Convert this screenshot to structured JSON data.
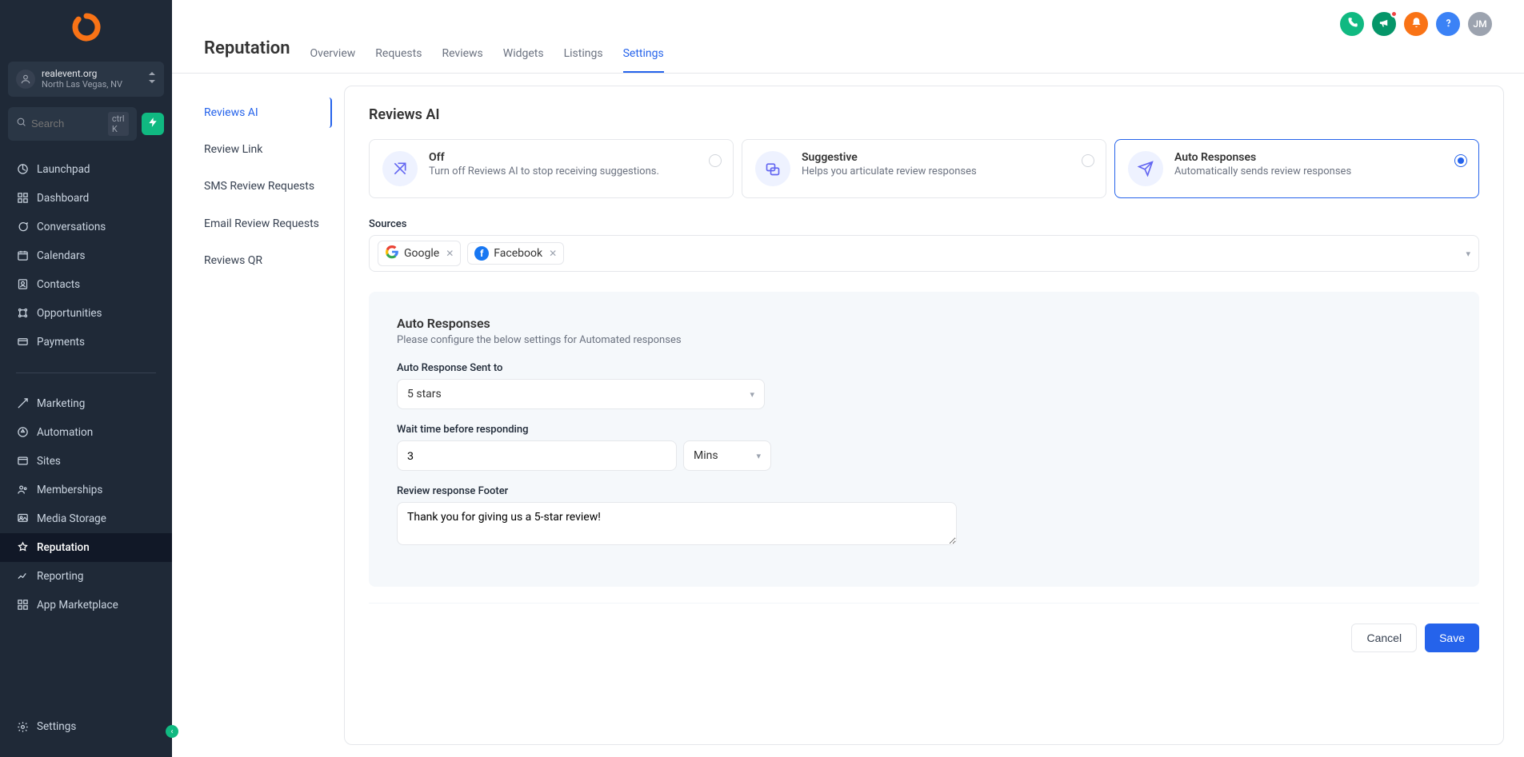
{
  "location": {
    "name": "realevent.org",
    "sub": "North Las Vegas, NV"
  },
  "search": {
    "placeholder": "Search",
    "shortcut": "ctrl K"
  },
  "nav_top": [
    {
      "label": "Launchpad"
    },
    {
      "label": "Dashboard"
    },
    {
      "label": "Conversations"
    },
    {
      "label": "Calendars"
    },
    {
      "label": "Contacts"
    },
    {
      "label": "Opportunities"
    },
    {
      "label": "Payments"
    }
  ],
  "nav_bottom": [
    {
      "label": "Marketing"
    },
    {
      "label": "Automation"
    },
    {
      "label": "Sites"
    },
    {
      "label": "Memberships"
    },
    {
      "label": "Media Storage"
    },
    {
      "label": "Reputation"
    },
    {
      "label": "Reporting"
    },
    {
      "label": "App Marketplace"
    }
  ],
  "nav_settings": "Settings",
  "avatar": "JM",
  "page_title": "Reputation",
  "tabs": [
    "Overview",
    "Requests",
    "Reviews",
    "Widgets",
    "Listings",
    "Settings"
  ],
  "active_tab": "Settings",
  "subnav": [
    "Reviews AI",
    "Review Link",
    "SMS Review Requests",
    "Email Review Requests",
    "Reviews QR"
  ],
  "active_subnav": "Reviews AI",
  "panel_title": "Reviews AI",
  "options": [
    {
      "title": "Off",
      "desc": "Turn off Reviews AI to stop receiving suggestions."
    },
    {
      "title": "Suggestive",
      "desc": "Helps you articulate review responses"
    },
    {
      "title": "Auto Responses",
      "desc": "Automatically sends review responses"
    }
  ],
  "selected_option": 2,
  "sources_label": "Sources",
  "sources": [
    "Google",
    "Facebook"
  ],
  "config": {
    "heading": "Auto Responses",
    "sub": "Please configure the below settings for Automated responses",
    "sent_to_label": "Auto Response Sent to",
    "sent_to_value": "5 stars",
    "wait_label": "Wait time before responding",
    "wait_value": "3",
    "wait_unit": "Mins",
    "footer_label": "Review response Footer",
    "footer_value": "Thank you for giving us a 5-star review!"
  },
  "buttons": {
    "cancel": "Cancel",
    "save": "Save"
  }
}
